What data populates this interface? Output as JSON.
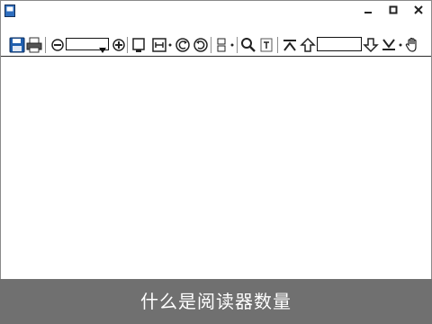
{
  "window": {
    "title": ""
  },
  "title_buttons": {
    "minimize_icon": "minimize-icon",
    "maximize_icon": "maximize-icon",
    "close_icon": "close-icon"
  },
  "menu": {
    "items": [
      {
        "label": ""
      },
      {
        "label": ""
      },
      {
        "label": ""
      },
      {
        "label": ""
      },
      {
        "label": ""
      },
      {
        "label": ""
      },
      {
        "label": ""
      }
    ]
  },
  "toolbar": {
    "zoom_combo": {
      "value": ""
    },
    "page_input": {
      "value": "",
      "placeholder": ""
    }
  },
  "caption": {
    "text": "什么是阅读器数量"
  },
  "colors": {
    "caption_bg": "#707070",
    "caption_text": "#ffffff",
    "save_icon": "#1f5fae",
    "toolbar_border": "#2b2b2b"
  }
}
